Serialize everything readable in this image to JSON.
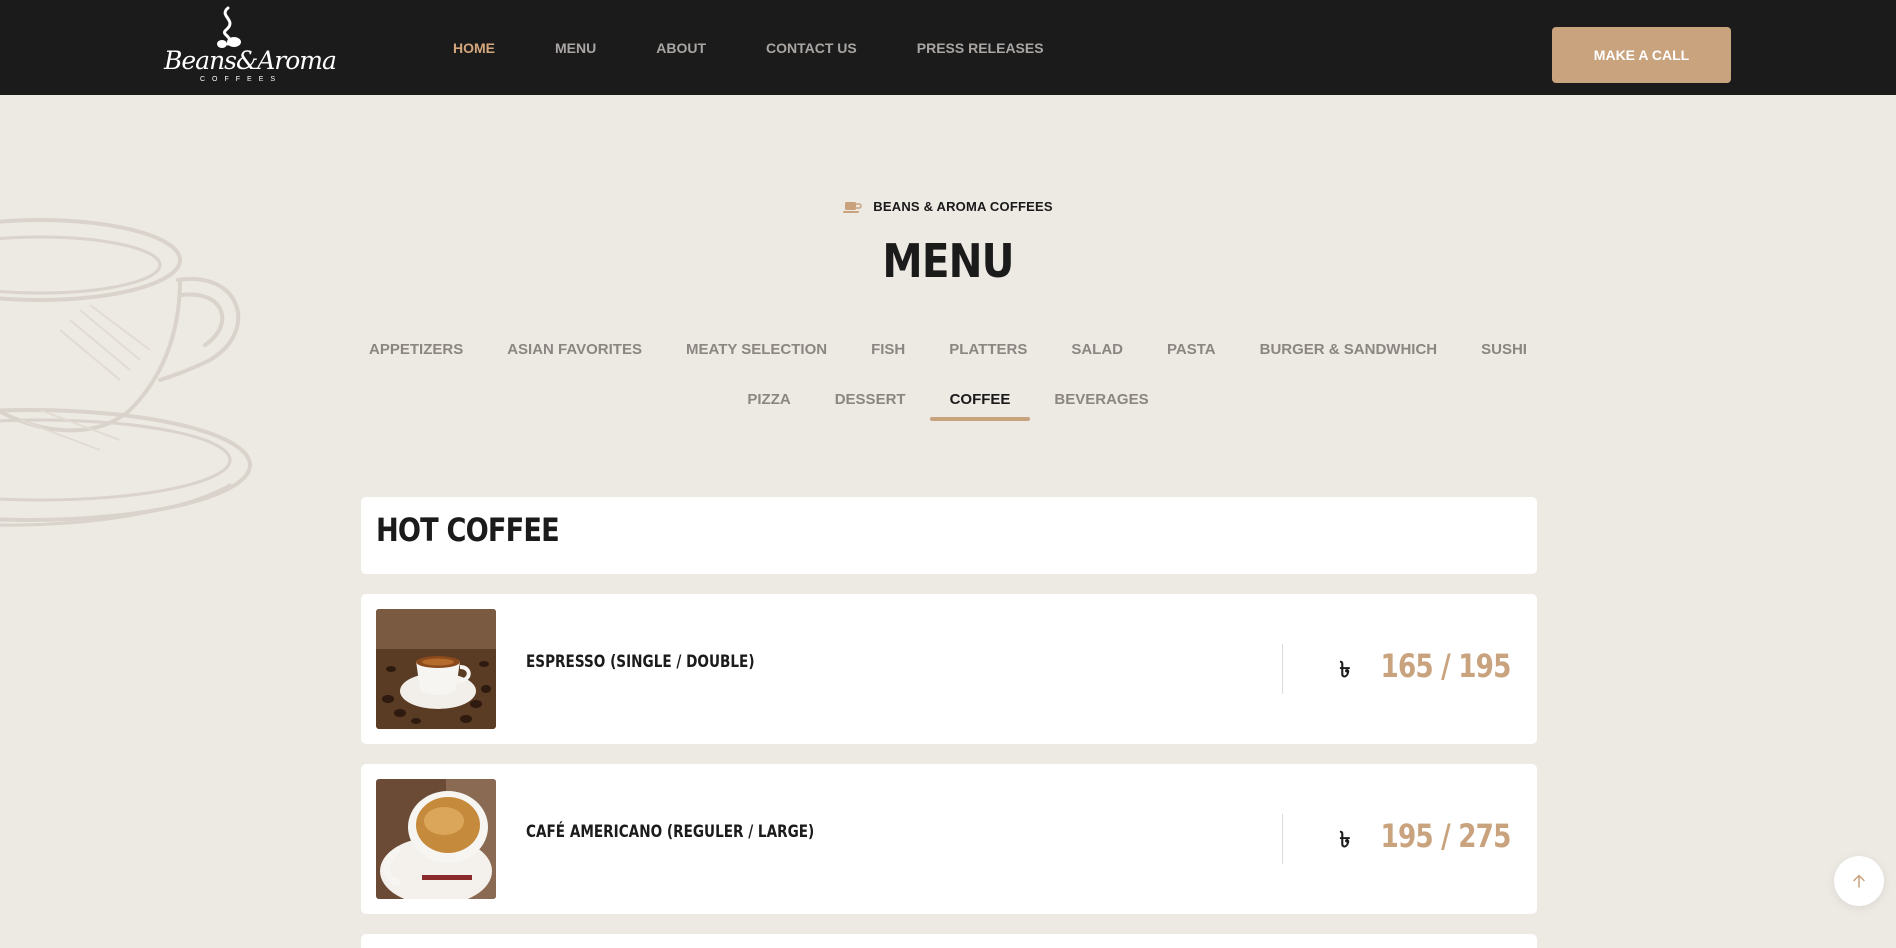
{
  "brand": {
    "logo_text": "Beans&Aroma",
    "logo_subtext": "COFFEES"
  },
  "nav": {
    "items": [
      {
        "label": "HOME",
        "active": true
      },
      {
        "label": "MENU",
        "active": false
      },
      {
        "label": "ABOUT",
        "active": false
      },
      {
        "label": "CONTACT US",
        "active": false
      },
      {
        "label": "PRESS RELEASES",
        "active": false
      }
    ],
    "cta_label": "MAKE A CALL"
  },
  "section": {
    "eyebrow": "BEANS & AROMA COFFEES",
    "title": "MENU"
  },
  "categories": {
    "row1": [
      "APPETIZERS",
      "ASIAN FAVORITES",
      "MEATY SELECTION",
      "FISH",
      "PLATTERS",
      "SALAD",
      "PASTA",
      "BURGER & SANDWHICH",
      "SUSHI"
    ],
    "row2": [
      "PIZZA",
      "DESSERT",
      "COFFEE",
      "BEVERAGES"
    ],
    "active": "COFFEE"
  },
  "menu": {
    "group_title": "HOT COFFEE",
    "currency_symbol": "৳",
    "items": [
      {
        "name": "ESPRESSO (SINGLE / DOUBLE)",
        "price": "165 / 195",
        "image": "espresso-cup-photo"
      },
      {
        "name": "CAFÉ AMERICANO (REGULER / LARGE)",
        "price": "195 / 275",
        "image": "americano-cup-photo"
      }
    ]
  },
  "colors": {
    "header_bg": "#1c1b1b",
    "accent": "#c9a27e",
    "page_bg": "#ede9e3"
  },
  "icons": {
    "eyebrow": "coffee-cup-icon",
    "back_to_top": "arrow-up-icon"
  }
}
